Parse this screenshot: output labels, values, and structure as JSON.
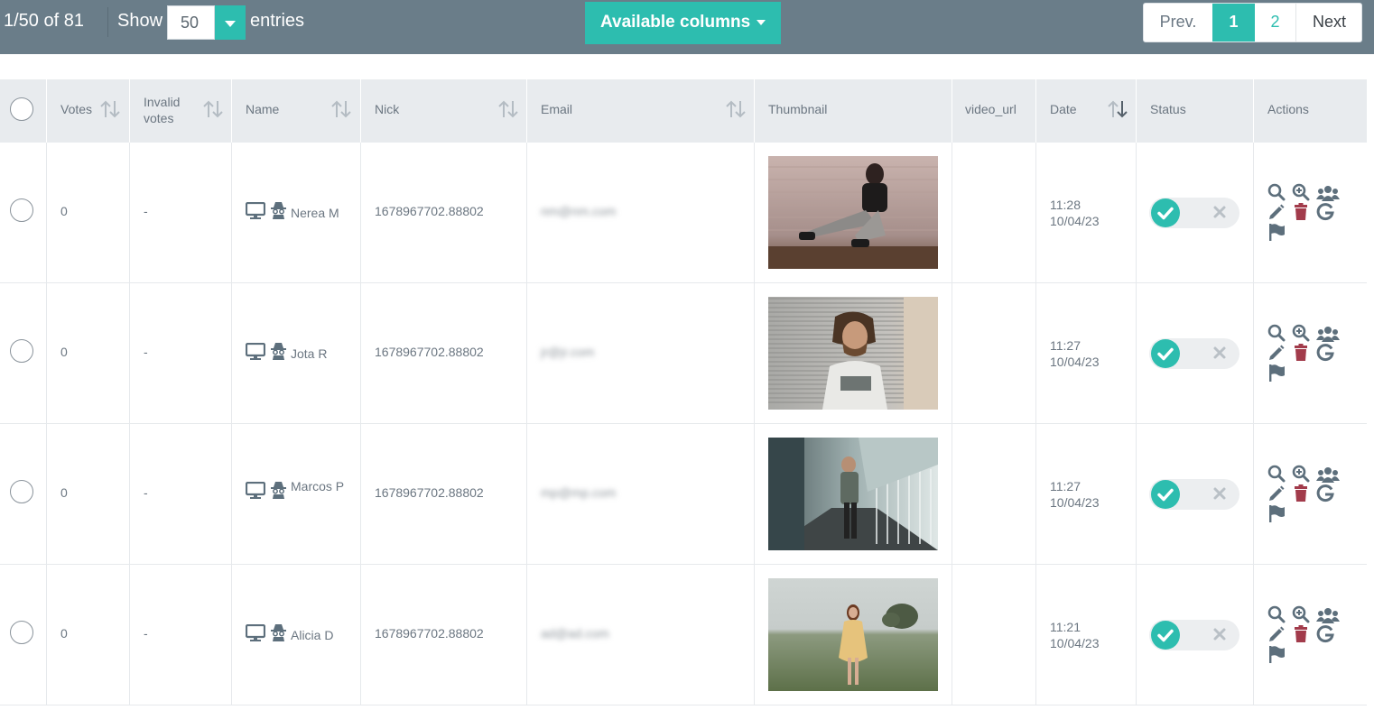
{
  "toolbar": {
    "page_info": "1/50 of 81",
    "show_label": "Show",
    "page_size": "50",
    "entries_label": "entries",
    "available_columns_label": "Available columns",
    "pagination": {
      "prev": "Prev.",
      "pages": [
        "1",
        "2"
      ],
      "current": "1",
      "next": "Next"
    }
  },
  "columns": {
    "votes": "Votes",
    "invalid_votes_line1": "Invalid",
    "invalid_votes_line2": "votes",
    "name": "Name",
    "nick": "Nick",
    "email": "Email",
    "thumbnail": "Thumbnail",
    "video_url": "video_url",
    "date": "Date",
    "status": "Status",
    "actions": "Actions"
  },
  "rows": [
    {
      "votes": "0",
      "invalid_votes": "-",
      "name": "Nerea M",
      "nick": "1678967702.88802",
      "email": "nm@nm.com",
      "time": "11:28",
      "date": "10/04/23",
      "status_on": true
    },
    {
      "votes": "0",
      "invalid_votes": "-",
      "name": "Jota R",
      "nick": "1678967702.88802",
      "email": "jr@jr.com",
      "time": "11:27",
      "date": "10/04/23",
      "status_on": true
    },
    {
      "votes": "0",
      "invalid_votes": "-",
      "name": "Marcos P",
      "nick": "1678967702.88802",
      "email": "mp@mp.com",
      "time": "11:27",
      "date": "10/04/23",
      "status_on": true
    },
    {
      "votes": "0",
      "invalid_votes": "-",
      "name": "Alicia D",
      "nick": "1678967702.88802",
      "email": "ad@ad.com",
      "time": "11:21",
      "date": "10/04/23",
      "status_on": true
    }
  ],
  "colors": {
    "accent": "#2dbdaf",
    "toolbar": "#6a7d89",
    "header_bg": "#e8ebee",
    "icon": "#5d6f7c",
    "delete": "#a23b4b"
  },
  "icons": [
    "monitor-icon",
    "spy-icon",
    "search-icon",
    "zoom-in-icon",
    "users-icon",
    "pencil-icon",
    "trash-icon",
    "google-icon",
    "flag-icon",
    "check-icon",
    "close-icon",
    "sort-icon"
  ]
}
